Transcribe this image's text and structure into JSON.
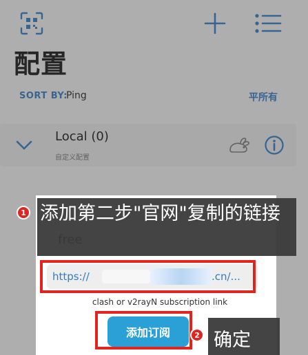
{
  "header": {
    "title": "配置",
    "icons": {
      "qr": "qr-code-icon",
      "add": "plus-icon",
      "menu": "list-menu-icon"
    }
  },
  "sort": {
    "label": "SORT BY:",
    "value": "Ping",
    "right_label": "平所有"
  },
  "group": {
    "name": "Local (0)",
    "subtitle": "自定义配置",
    "icons": {
      "toggle": "chevron-down-icon",
      "speed": "rabbit-icon",
      "info": "info-icon"
    }
  },
  "modal": {
    "name_field_value": "free",
    "url_value": "https://...                                a.cn/...",
    "url_prefix": "https://",
    "url_suffix": "a.cn/...",
    "hint": "clash or v2rayN subscription link",
    "add_button": "添加订阅"
  },
  "annotations": {
    "step1_badge": "1",
    "step1_text": "添加第二步\"官网\"复制的链接",
    "step2_badge": "2",
    "step2_text": "确定",
    "highlight_color": "#e0241f"
  },
  "colors": {
    "accent": "#2f7bc9",
    "button": "#2aa0d6",
    "overlay": "#464646"
  }
}
